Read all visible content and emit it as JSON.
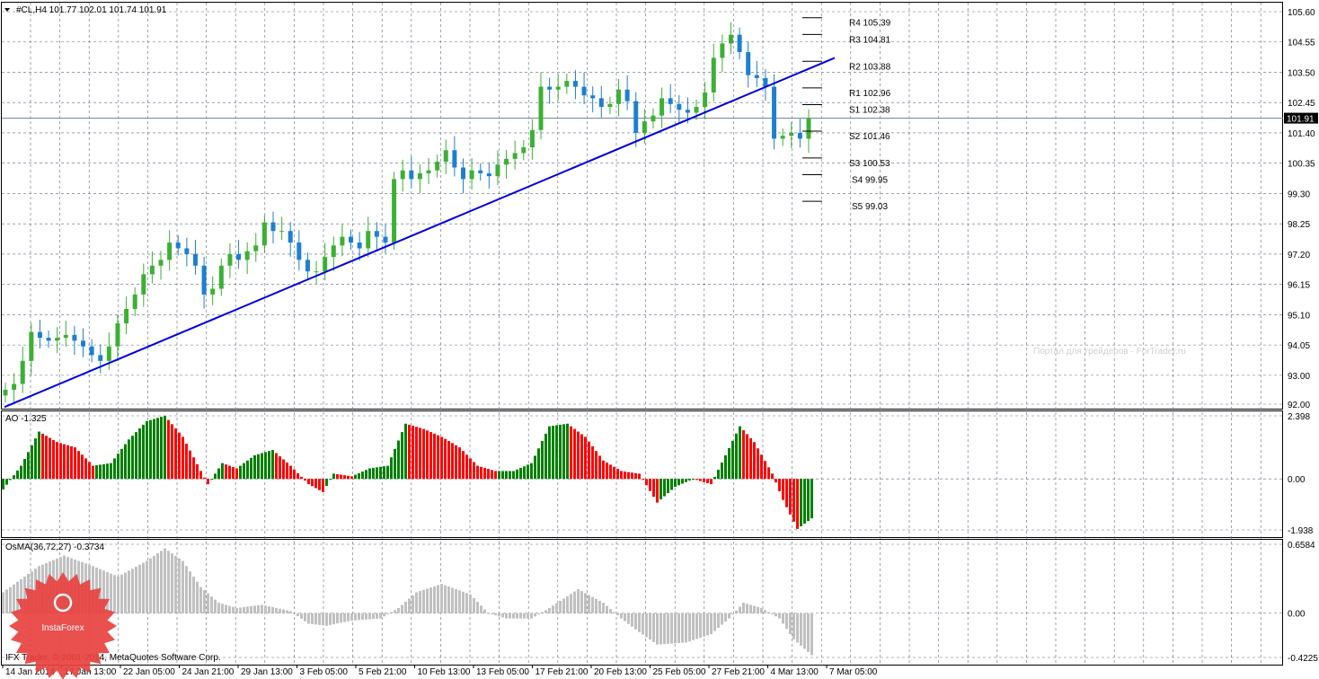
{
  "header": {
    "symbol": "#CL,H4",
    "ohlc": "101.77 102.01 101.74 101.91"
  },
  "watermark": "Портал для трейдеров - ForTrader.ru",
  "copyright": "IFX Trader, © 2001-2014, MetaQuotes Software Corp.",
  "logo_text": "InstaForex",
  "colors": {
    "bull": "#3cb034",
    "bear": "#1e7fd0",
    "trend": "#0000e0",
    "ao_up": "#008000",
    "ao_down": "#ff0000",
    "osma": "#c0c0c0",
    "grid": "#5a6a80"
  },
  "chart_data": [
    {
      "type": "candlestick",
      "title": "#CL,H4",
      "ylim": [
        91.9,
        105.9
      ],
      "yticks": [
        "105.60",
        "104.55",
        "103.50",
        "102.45",
        "101.40",
        "100.35",
        "99.30",
        "98.25",
        "97.20",
        "96.15",
        "95.10",
        "94.05",
        "93.00",
        "92.00"
      ],
      "ytick_values": [
        105.6,
        104.55,
        103.5,
        102.45,
        101.4,
        100.35,
        99.3,
        98.25,
        97.2,
        96.15,
        95.1,
        94.05,
        93.0,
        92.0
      ],
      "current_price": "101.91",
      "closes": [
        92.5,
        92.7,
        93.5,
        94.5,
        94.3,
        94.2,
        94.3,
        94.4,
        94.2,
        94.0,
        93.7,
        93.5,
        94.0,
        94.8,
        95.3,
        95.8,
        96.5,
        96.8,
        97.0,
        97.6,
        97.4,
        97.2,
        96.8,
        95.8,
        96.0,
        96.8,
        97.2,
        97.0,
        97.3,
        97.5,
        98.3,
        98.0,
        98.0,
        97.6,
        97.0,
        96.6,
        96.6,
        97.1,
        97.5,
        97.8,
        97.6,
        97.4,
        98.0,
        97.8,
        97.6,
        99.8,
        100.1,
        99.8,
        100.0,
        100.1,
        100.4,
        100.8,
        100.2,
        99.8,
        100.1,
        100.0,
        99.9,
        100.3,
        100.5,
        100.7,
        100.9,
        101.5,
        103.0,
        102.9,
        103.0,
        103.2,
        103.0,
        102.7,
        102.6,
        102.3,
        102.4,
        102.9,
        102.5,
        101.4,
        101.8,
        102.0,
        102.6,
        102.4,
        102.2,
        102.1,
        102.3,
        102.8,
        104.0,
        104.5,
        104.8,
        104.2,
        103.4,
        103.3,
        103.0,
        101.2,
        101.3,
        101.4,
        101.2,
        101.9
      ],
      "trendline": {
        "start": [
          0,
          91.9
        ],
        "end": [
          231,
          104.0
        ]
      },
      "pivots": [
        {
          "label": "R4 105.39",
          "value": 105.39
        },
        {
          "label": "R3 104.81",
          "value": 104.81
        },
        {
          "label": "R2 103.88",
          "value": 103.88
        },
        {
          "label": "R1 102.96",
          "value": 102.96
        },
        {
          "label": "S1 102.38",
          "value": 102.38
        },
        {
          "label": "S2 101.46",
          "value": 101.46
        },
        {
          "label": "S3 100.53",
          "value": 100.53
        },
        {
          "label": "S4 99.95",
          "value": 99.95
        },
        {
          "label": "S5 99.03",
          "value": 99.03
        }
      ],
      "xticks": [
        "14 Jan 2014",
        "17 Jan 13:00",
        "22 Jan 05:00",
        "24 Jan 21:00",
        "29 Jan 13:00",
        "3 Feb 05:00",
        "5 Feb 21:00",
        "10 Feb 13:00",
        "13 Feb 05:00",
        "17 Feb 21:00",
        "20 Feb 13:00",
        "25 Feb 05:00",
        "27 Feb 21:00",
        "4 Mar 13:00",
        "7 Mar 05:00"
      ]
    },
    {
      "type": "histogram",
      "title": "AO -1.325",
      "ylim": [
        -1.938,
        2.398
      ],
      "yticks": [
        "2.398",
        "0.00",
        "-1.938"
      ],
      "ytick_values": [
        2.398,
        0,
        -1.938
      ],
      "keypoints": [
        [
          0,
          -0.4
        ],
        [
          5,
          0.5
        ],
        [
          10,
          1.8
        ],
        [
          15,
          1.4
        ],
        [
          20,
          1.2
        ],
        [
          25,
          0.5
        ],
        [
          30,
          0.6
        ],
        [
          35,
          1.5
        ],
        [
          40,
          2.2
        ],
        [
          45,
          2.4
        ],
        [
          50,
          1.6
        ],
        [
          55,
          0.3
        ],
        [
          57,
          -0.2
        ],
        [
          61,
          0.6
        ],
        [
          65,
          0.4
        ],
        [
          70,
          0.9
        ],
        [
          75,
          1.1
        ],
        [
          80,
          0.5
        ],
        [
          85,
          -0.2
        ],
        [
          89,
          -0.5
        ],
        [
          92,
          0.2
        ],
        [
          97,
          0.1
        ],
        [
          102,
          0.4
        ],
        [
          107,
          0.5
        ],
        [
          112,
          2.1
        ],
        [
          117,
          1.9
        ],
        [
          122,
          1.6
        ],
        [
          127,
          1.2
        ],
        [
          132,
          0.5
        ],
        [
          137,
          0.3
        ],
        [
          142,
          0.3
        ],
        [
          147,
          0.6
        ],
        [
          152,
          2.0
        ],
        [
          157,
          2.1
        ],
        [
          162,
          1.6
        ],
        [
          167,
          0.7
        ],
        [
          172,
          0.3
        ],
        [
          177,
          0.2
        ],
        [
          182,
          -0.9
        ],
        [
          187,
          -0.3
        ],
        [
          192,
          0.0
        ],
        [
          197,
          -0.2
        ],
        [
          201,
          0.9
        ],
        [
          205,
          2.0
        ],
        [
          209,
          1.4
        ],
        [
          214,
          0.2
        ],
        [
          217,
          -0.8
        ],
        [
          221,
          -1.9
        ],
        [
          225,
          -1.5
        ]
      ]
    },
    {
      "type": "histogram",
      "title": "OsMA(36,72,27) -0.3734",
      "ylim": [
        -0.4225,
        0.6584
      ],
      "yticks": [
        "0.6584",
        "0.00",
        "-0.4225"
      ],
      "ytick_values": [
        0.6584,
        0,
        -0.4225
      ],
      "keypoints": [
        [
          0,
          0.2
        ],
        [
          10,
          0.45
        ],
        [
          17,
          0.55
        ],
        [
          25,
          0.45
        ],
        [
          32,
          0.35
        ],
        [
          40,
          0.5
        ],
        [
          45,
          0.62
        ],
        [
          50,
          0.5
        ],
        [
          55,
          0.25
        ],
        [
          60,
          0.1
        ],
        [
          65,
          0.05
        ],
        [
          72,
          0.08
        ],
        [
          80,
          0.02
        ],
        [
          85,
          -0.1
        ],
        [
          90,
          -0.12
        ],
        [
          97,
          -0.07
        ],
        [
          105,
          -0.05
        ],
        [
          110,
          0.05
        ],
        [
          115,
          0.2
        ],
        [
          122,
          0.28
        ],
        [
          130,
          0.18
        ],
        [
          135,
          0.0
        ],
        [
          140,
          -0.05
        ],
        [
          147,
          -0.05
        ],
        [
          152,
          0.05
        ],
        [
          160,
          0.23
        ],
        [
          167,
          0.1
        ],
        [
          172,
          -0.05
        ],
        [
          177,
          -0.18
        ],
        [
          182,
          -0.3
        ],
        [
          190,
          -0.28
        ],
        [
          197,
          -0.2
        ],
        [
          202,
          -0.05
        ],
        [
          206,
          0.1
        ],
        [
          211,
          0.05
        ],
        [
          216,
          -0.05
        ],
        [
          220,
          -0.25
        ],
        [
          225,
          -0.4
        ]
      ]
    }
  ]
}
